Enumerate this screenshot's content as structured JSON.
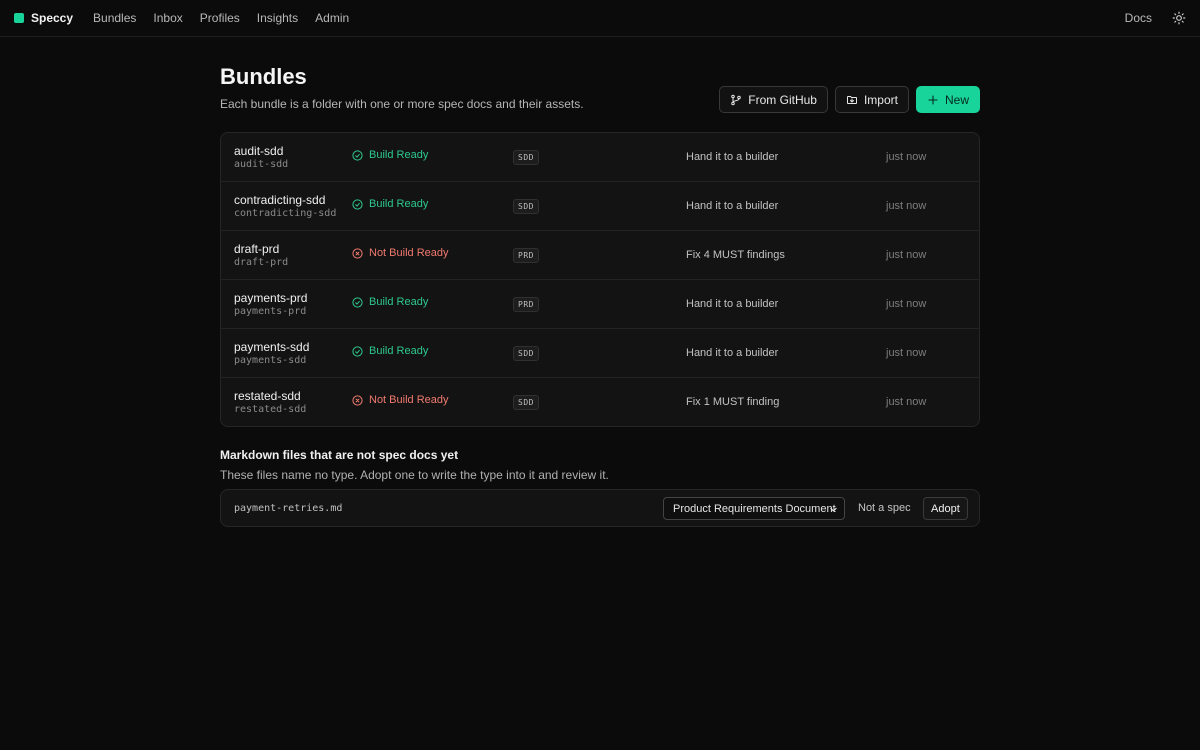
{
  "nav": {
    "brand": "Speccy",
    "items": [
      "Bundles",
      "Inbox",
      "Profiles",
      "Insights",
      "Admin"
    ],
    "docs": "Docs",
    "theme_icon": "sun-icon"
  },
  "header": {
    "title": "Bundles",
    "subtitle": "Each bundle is a folder with one or more spec docs and their assets.",
    "actions": {
      "github": "From GitHub",
      "import": "Import",
      "new": "New"
    }
  },
  "bundles": [
    {
      "name": "audit-sdd",
      "slug": "audit-sdd",
      "status": "Build Ready",
      "ready": true,
      "type": "SDD",
      "next": "Hand it to a builder",
      "updated": "just now"
    },
    {
      "name": "contradicting-sdd",
      "slug": "contradicting-sdd",
      "status": "Build Ready",
      "ready": true,
      "type": "SDD",
      "next": "Hand it to a builder",
      "updated": "just now"
    },
    {
      "name": "draft-prd",
      "slug": "draft-prd",
      "status": "Not Build Ready",
      "ready": false,
      "type": "PRD",
      "next": "Fix 4 MUST findings",
      "updated": "just now"
    },
    {
      "name": "payments-prd",
      "slug": "payments-prd",
      "status": "Build Ready",
      "ready": true,
      "type": "PRD",
      "next": "Hand it to a builder",
      "updated": "just now"
    },
    {
      "name": "payments-sdd",
      "slug": "payments-sdd",
      "status": "Build Ready",
      "ready": true,
      "type": "SDD",
      "next": "Hand it to a builder",
      "updated": "just now"
    },
    {
      "name": "restated-sdd",
      "slug": "restated-sdd",
      "status": "Not Build Ready",
      "ready": false,
      "type": "SDD",
      "next": "Fix 1 MUST finding",
      "updated": "just now"
    }
  ],
  "untyped": {
    "title": "Markdown files that are not spec docs yet",
    "subtitle": "These files name no type. Adopt one to write the type into it and review it.",
    "files": [
      {
        "name": "payment-retries.md",
        "selected_type": "Product Requirements Document",
        "not_spec": "Not a spec",
        "adopt": "Adopt"
      }
    ]
  },
  "colors": {
    "accent": "#19d49a",
    "ready": "#2ec98f",
    "not_ready": "#f07a6f",
    "background": "#0b0b0b"
  }
}
